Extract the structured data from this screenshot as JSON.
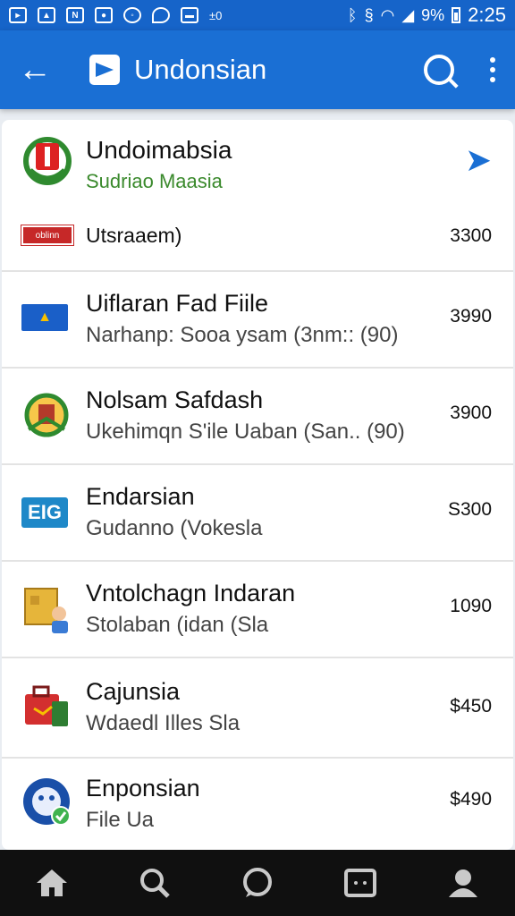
{
  "status_bar": {
    "left_icons": [
      "notification-icon",
      "signal-app-icon",
      "news-icon",
      "app-icon",
      "sync-icon",
      "location-icon",
      "image-icon",
      "stat-icon"
    ],
    "left_icon_labels": [
      "",
      "",
      "N",
      "",
      "",
      "",
      "",
      "±0"
    ],
    "bluetooth": "bluetooth-icon",
    "battery": "9%",
    "time": "2:25"
  },
  "app_bar": {
    "title": "Undonsian"
  },
  "header": {
    "title": "Undoimabsia",
    "subtitle": "Sudriao Maasia"
  },
  "rows": [
    {
      "icon": "flag-logo-icon",
      "icon_text": "oblinn",
      "title": "Utsraaem)",
      "subtitle": "",
      "price": "3300"
    },
    {
      "icon": "flag-icon",
      "icon_text": "",
      "title": "Uiflaran Fad Fiile",
      "subtitle": "Narhanp: Sooa ysam (3nm:: (90)",
      "price": "3990"
    },
    {
      "icon": "emblem-icon",
      "icon_text": "",
      "title": "Nolsam Safdash",
      "subtitle": "Ukehimqn S'ile Uaban (San.. (90)",
      "price": "3900"
    },
    {
      "icon": "eig-logo-icon",
      "icon_text": "EIG",
      "title": "Endarsian",
      "subtitle": "Gudanno (Vokesla",
      "price": "S300"
    },
    {
      "icon": "box-person-icon",
      "icon_text": "",
      "title": "Vntolchagn Indaran",
      "subtitle": "Stolaban (idan (Sla",
      "price": "1090"
    },
    {
      "icon": "suitcase-icon",
      "icon_text": "",
      "title": "Cajunsia",
      "subtitle": "Wdaedl Illes Sla",
      "price": "$450"
    },
    {
      "icon": "globe-check-icon",
      "icon_text": "",
      "title": "Enponsian",
      "subtitle": "File Ua",
      "price": "$490"
    }
  ],
  "nav": [
    "home-icon",
    "search-icon",
    "chat-icon",
    "card-icon",
    "profile-icon"
  ]
}
